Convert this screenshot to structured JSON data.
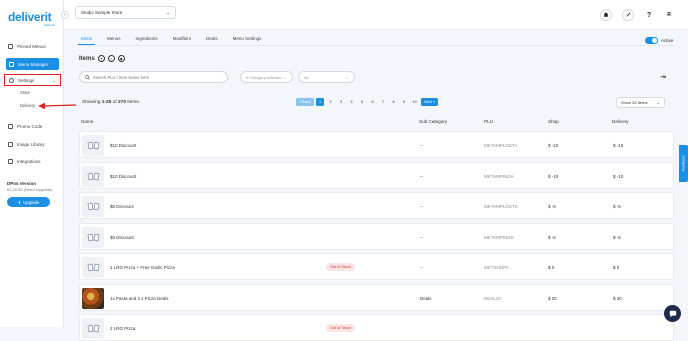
{
  "app": {
    "logo": "deliverit",
    "logo_sub": "deliverit"
  },
  "sidebar": {
    "collapse": "‹",
    "items": [
      {
        "label": "Pinned Menus",
        "icon": "pin-icon"
      },
      {
        "label": "Menu Manager",
        "icon": "menu-icon"
      },
      {
        "label": "Settings",
        "icon": "gear-icon"
      },
      {
        "label": "Promo Code",
        "icon": "tag-icon"
      },
      {
        "label": "Image Library",
        "icon": "image-icon"
      },
      {
        "label": "Integrations",
        "icon": "plug-icon"
      }
    ],
    "settings_chevron": "⌄",
    "sub_items": [
      "Store",
      "Delivery"
    ],
    "version_title": "DPos Version",
    "version_value": "02.20.50 (Need Upgrade)",
    "upgrade_label": "Upgrade",
    "highlight_color": "#e0201f"
  },
  "topbar": {
    "store_name": "Studio Sample Store",
    "store_chevron": "⌄",
    "icons": [
      "bell-icon",
      "rocket-icon",
      "help-icon",
      "avatar"
    ],
    "avatar_letter": "R",
    "help_glyph": "?"
  },
  "tabs": [
    "Items",
    "Menus",
    "Ingredients",
    "Modifiers",
    "Deals",
    "Menu Settings"
  ],
  "active_toggle_label": "Active",
  "items_section": {
    "title": "Items"
  },
  "filters": {
    "search_placeholder": "Search PLU / Item Name here",
    "category_placeholder": "0 Category selected",
    "all_label": "All"
  },
  "pagination": {
    "summary_prefix": "Showing ",
    "summary_range": "1-25",
    "summary_of": " of ",
    "summary_total": "270",
    "summary_suffix": " items.",
    "prev": "« Back",
    "pages": [
      "1",
      "2",
      "3",
      "4",
      "5",
      "6",
      "7",
      "8",
      "9",
      "10"
    ],
    "current_page": "1",
    "next": "Next »",
    "show_label": "Show 25 Items"
  },
  "table": {
    "headers": [
      "Name",
      "Sub Category",
      "PLU",
      "Shop",
      "Delivery"
    ],
    "rows": [
      {
        "name": "$10 Discount",
        "sub": "--",
        "plu": "MKTAMPLOSTA",
        "shop": "$ -10",
        "delivery": "$ -10",
        "badge": "",
        "thumb": "placeholder"
      },
      {
        "name": "$10 Discount",
        "sub": "--",
        "plu": "MKTAMPINDA",
        "shop": "$ -10",
        "delivery": "$ -10",
        "badge": "",
        "thumb": "placeholder"
      },
      {
        "name": "$5 Discount",
        "sub": "--",
        "plu": "MKTAMPLOSTS",
        "shop": "$ -5",
        "delivery": "$ -5",
        "badge": "",
        "thumb": "placeholder"
      },
      {
        "name": "$5 Discount",
        "sub": "--",
        "plu": "MKTAMPINDS",
        "shop": "$ -5",
        "delivery": "$ -5",
        "badge": "",
        "thumb": "placeholder"
      },
      {
        "name": "1 LRG Pizza + Free Garlic Pizza",
        "sub": "--",
        "plu": "MKTSHOPA",
        "shop": "$ 0",
        "delivery": "$ 0",
        "badge": "Out of Stock",
        "thumb": "placeholder"
      },
      {
        "name": "1x Pasta and 2 x Pizza Deals",
        "sub": "Deals",
        "plu": "DEAL10",
        "shop": "$ 20",
        "delivery": "$ 20",
        "badge": "",
        "thumb": "photo"
      },
      {
        "name": "2 LRG Pizza",
        "sub": "",
        "plu": "",
        "shop": "",
        "delivery": "",
        "badge": "Out of Stock",
        "thumb": "placeholder"
      }
    ]
  },
  "feedback_label": "Feedback",
  "chat_icon": "chat-icon",
  "colors": {
    "accent": "#1a8fe3",
    "danger": "#e0201f"
  }
}
